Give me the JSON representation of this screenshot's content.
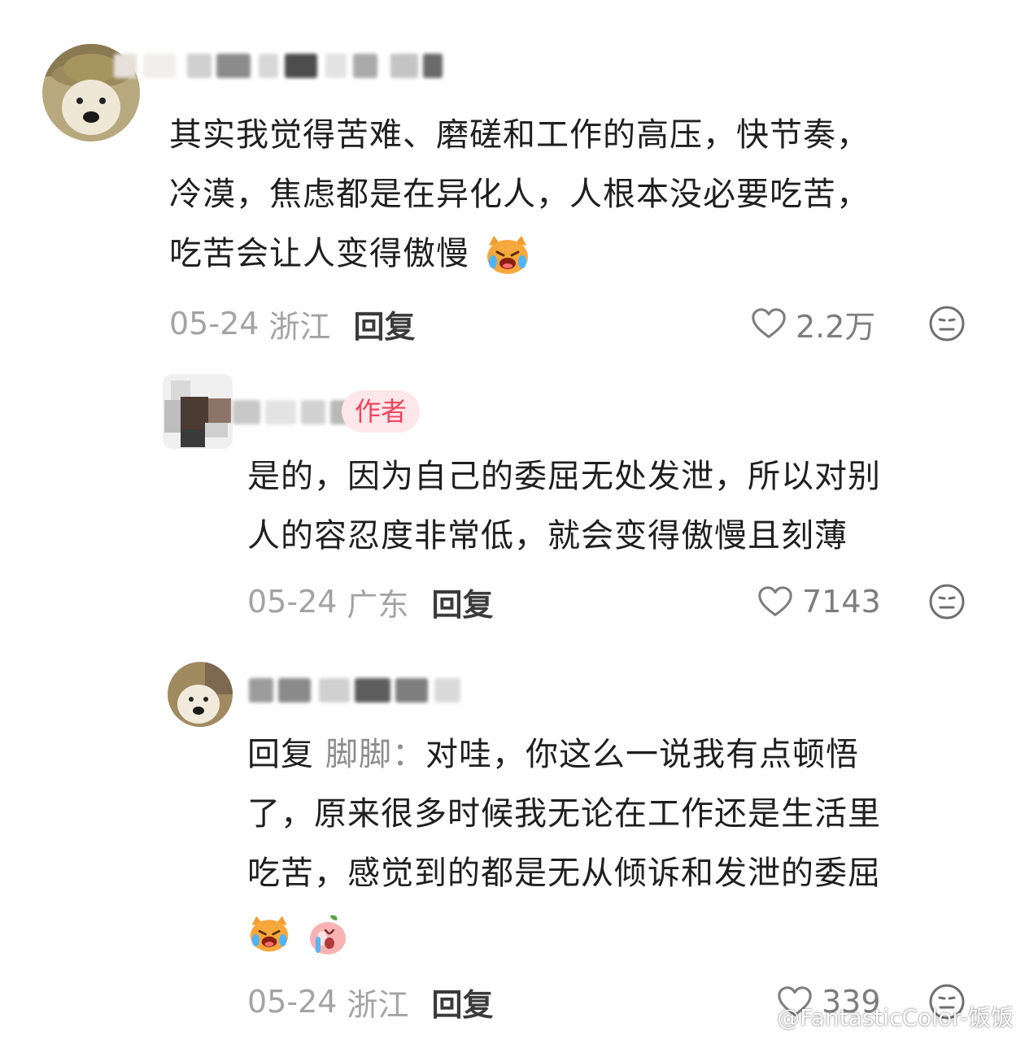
{
  "comments": [
    {
      "text_lines": [
        "其实我觉得苦难、磨磋和工作的高压，快节奏，",
        "冷漠，焦虑都是在异化人，人根本没必要吃苦，",
        "吃苦会让人变得傲慢"
      ],
      "date": "05-24",
      "location": "浙江",
      "reply_label": "回复",
      "likes": "2.2万"
    },
    {
      "author_badge": "作者",
      "text_lines": [
        "是的，因为自己的委屈无处发泄，所以对别",
        "人的容忍度非常低，就会变得傲慢且刻薄"
      ],
      "date": "05-24",
      "location": "广东",
      "reply_label": "回复",
      "likes": "7143"
    },
    {
      "reply_prefix": "回复",
      "reply_target": "脚脚：",
      "text_first": "对哇，你这么一说我有点顿悟",
      "text_lines": [
        "了，原来很多时候我无论在工作还是生活里",
        "吃苦，感觉到的都是无从倾诉和发泄的委屈"
      ],
      "date": "05-24",
      "location": "浙江",
      "reply_label": "回复",
      "likes": "339"
    }
  ],
  "watermark": "@FantasticColor-饭饭",
  "icons": {
    "like": "heart-outline-icon",
    "dislike": "neutral-face-icon",
    "emoji_crying_cat": "crying-cat-emoji",
    "emoji_crying_peach": "crying-peach-emoji",
    "watermark_logo": "weibo-logo-icon"
  },
  "colors": {
    "author_badge_bg": "#fde7ea",
    "author_badge_text": "#f0445e",
    "meta_gray": "#a3a3a3"
  }
}
